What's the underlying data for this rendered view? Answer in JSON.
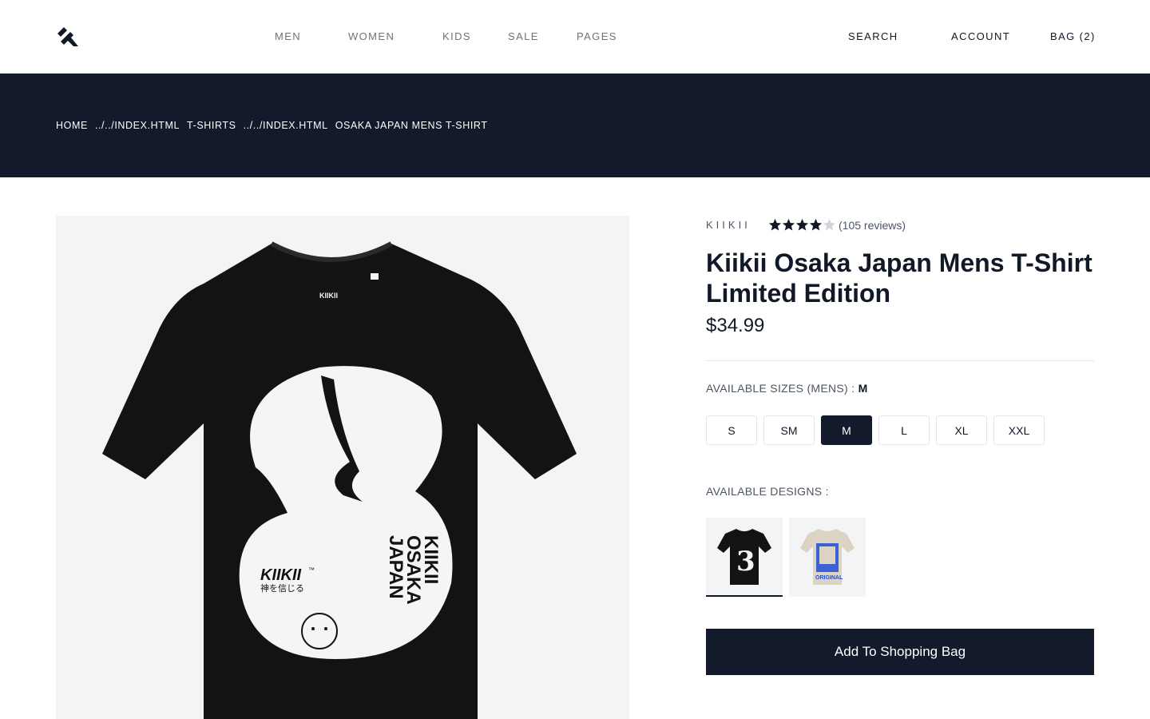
{
  "header": {
    "logo": "brand-logo",
    "nav": [
      "MEN",
      "WOMEN",
      "KIDS",
      "SALE",
      "PAGES"
    ],
    "search_label": "SEARCH",
    "account_label": "ACCOUNT",
    "bag_label": "BAG (2)"
  },
  "breadcrumb": [
    "HOME",
    "../../INDEX.HTML",
    "T-SHIRTS",
    "../../INDEX.HTML",
    "OSAKA JAPAN MENS T-SHIRT"
  ],
  "product": {
    "brand": "KIIKII",
    "rating": 4,
    "rating_max": 5,
    "reviews": "(105 reviews)",
    "title": "Kiikii Osaka Japan Mens T-Shirt Limited Edition",
    "price": "$34.99",
    "sizes_label": "AVAILABLE SIZES (MENS)",
    "sizes_separator": " : ",
    "selected_size": "M",
    "sizes": [
      "S",
      "SM",
      "M",
      "L",
      "XL",
      "XXL"
    ],
    "designs_label": "AVAILABLE DESIGNS :",
    "designs": [
      "black-number-3-tee",
      "beige-original-tee"
    ],
    "image_text": {
      "brand_mark": "KIIKII",
      "tm": "™",
      "japanese": "神を信じる",
      "vertical_lines": [
        "KIIKII",
        "OSAKA",
        "JAPAN"
      ],
      "swatch_caption": "ORIGINAL",
      "numeral": "3"
    },
    "add_to_bag_label": "Add To Shopping Bag"
  },
  "colors": {
    "dark_navy": "#121a2b",
    "star_filled": "#111827",
    "star_empty": "#d1d5db",
    "image_bg": "#f3f4f6"
  }
}
